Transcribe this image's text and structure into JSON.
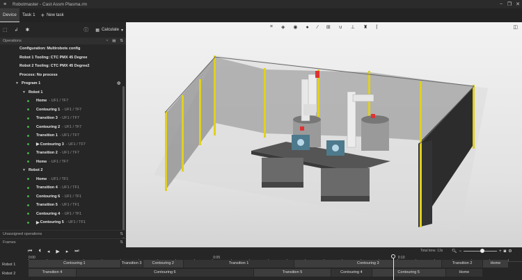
{
  "titlebar": {
    "title": "Robotmaster - Cast Assm Plasma.rm"
  },
  "tabs": [
    {
      "label": "Device"
    },
    {
      "label": "Task 1"
    }
  ],
  "new_task_label": "New task",
  "left_toolbar": {
    "calculate_label": "Calculate"
  },
  "operations_header": "Operations",
  "operations": [
    {
      "text": "Configuration: Multirobots config",
      "indent": 28,
      "kind": "plain"
    },
    {
      "text": "Robot 1 Tooling: CTC PMX 45 Degree",
      "indent": 28,
      "kind": "plain"
    },
    {
      "text": "Robot 2 Tooling: CTC PMX 45 Degree2",
      "indent": 28,
      "kind": "plain"
    },
    {
      "text": "Process: No process",
      "indent": 28,
      "kind": "plain"
    },
    {
      "text": "Program 1",
      "indent": 22,
      "kind": "group"
    },
    {
      "text": "Robot 1",
      "indent": 32,
      "kind": "group"
    },
    {
      "text": "Home",
      "sub": "- UF1 / TF7",
      "indent": 42,
      "kind": "op"
    },
    {
      "text": "Contouring 1",
      "sub": "- UF1 / TF7",
      "indent": 42,
      "kind": "op"
    },
    {
      "text": "Transition 3",
      "sub": "- UF1 / TF7",
      "indent": 42,
      "kind": "op"
    },
    {
      "text": "Contouring 2",
      "sub": "- UF1 / TF7",
      "indent": 42,
      "kind": "op"
    },
    {
      "text": "Transition 1",
      "sub": "- UF1 / TF7",
      "indent": 42,
      "kind": "op"
    },
    {
      "text": "Contouring 3",
      "sub": "- UF1 / TF7",
      "indent": 42,
      "kind": "op",
      "marker": true
    },
    {
      "text": "Transition 2",
      "sub": "- UF1 / TF7",
      "indent": 42,
      "kind": "op"
    },
    {
      "text": "Home",
      "sub": "- UF1 / TF7",
      "indent": 42,
      "kind": "op"
    },
    {
      "text": "Robot 2",
      "indent": 32,
      "kind": "group"
    },
    {
      "text": "Home",
      "sub": "- UF1 / TF1",
      "indent": 42,
      "kind": "op"
    },
    {
      "text": "Transition 4",
      "sub": "- UF1 / TF1",
      "indent": 42,
      "kind": "op"
    },
    {
      "text": "Contouring 6",
      "sub": "- UF1 / TF1",
      "indent": 42,
      "kind": "op"
    },
    {
      "text": "Transition 5",
      "sub": "- UF1 / TF1",
      "indent": 42,
      "kind": "op"
    },
    {
      "text": "Contouring 4",
      "sub": "- UF1 / TF1",
      "indent": 42,
      "kind": "op"
    },
    {
      "text": "Contouring 5",
      "sub": "- UF1 / TF1",
      "indent": 42,
      "kind": "op",
      "marker": true
    }
  ],
  "unassigned_label": "Unassigned operations",
  "frames_label": "Frames",
  "timeline": {
    "total_time": "Total time: 13s",
    "ruler_labels": [
      "0:00",
      "0:05",
      "0:10"
    ],
    "tracks": [
      {
        "name": "Robot 1",
        "segments": [
          {
            "label": "Contouring 1",
            "start": 0,
            "end": 2.5
          },
          {
            "label": "Transition 3",
            "start": 2.5,
            "end": 3.1
          },
          {
            "label": "Contouring 2",
            "start": 3.1,
            "end": 4.2
          },
          {
            "label": "Transition 1",
            "start": 4.2,
            "end": 7.2
          },
          {
            "label": "Contouring 3",
            "start": 7.2,
            "end": 11.2
          },
          {
            "label": "Transition 2",
            "start": 11.2,
            "end": 12.3
          },
          {
            "label": "Home",
            "start": 12.3,
            "end": 13.0
          }
        ]
      },
      {
        "name": "Robot 2",
        "segments": [
          {
            "label": "Transition 4",
            "start": 0,
            "end": 1.3
          },
          {
            "label": "Contouring 6",
            "start": 1.3,
            "end": 6.1
          },
          {
            "label": "Transition 5",
            "start": 6.1,
            "end": 8.2
          },
          {
            "label": "Contouring 4",
            "start": 8.2,
            "end": 9.3
          },
          {
            "label": "Contouring 5",
            "start": 9.3,
            "end": 11.3
          },
          {
            "label": "Home",
            "start": 11.3,
            "end": 12.3
          }
        ]
      }
    ],
    "total_seconds": 13,
    "playhead_seconds": 9.9
  }
}
